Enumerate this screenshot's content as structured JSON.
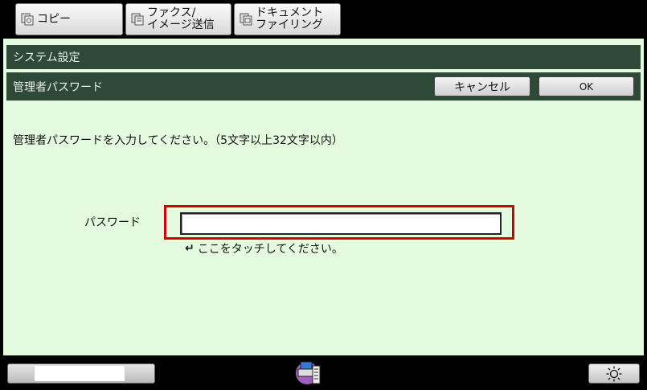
{
  "tabs": {
    "copy": {
      "label": "コピー",
      "icon": "copy-icon"
    },
    "fax": {
      "line1": "ファクス/",
      "line2": "イメージ送信",
      "icon": "fax-icon"
    },
    "document": {
      "line1": "ドキュメント",
      "line2": "ファイリング",
      "icon": "document-filing-icon"
    }
  },
  "header": {
    "section_title": "システム設定",
    "page_title": "管理者パスワード",
    "cancel_label": "キャンセル",
    "ok_label": "OK"
  },
  "main": {
    "instruction": "管理者パスワードを入力してください。（5文字以上32文字以内）",
    "password_label": "パスワード",
    "password_value": "",
    "hint": "ここをタッチしてください。",
    "hint_icon": "return-arrow-icon"
  },
  "footer": {
    "status_icon": "job-status-icon",
    "brightness_icon": "brightness-icon"
  },
  "colors": {
    "panel_bg": "#e4fbe0",
    "bar_bg": "#2e4a36",
    "highlight": "#d40000"
  }
}
